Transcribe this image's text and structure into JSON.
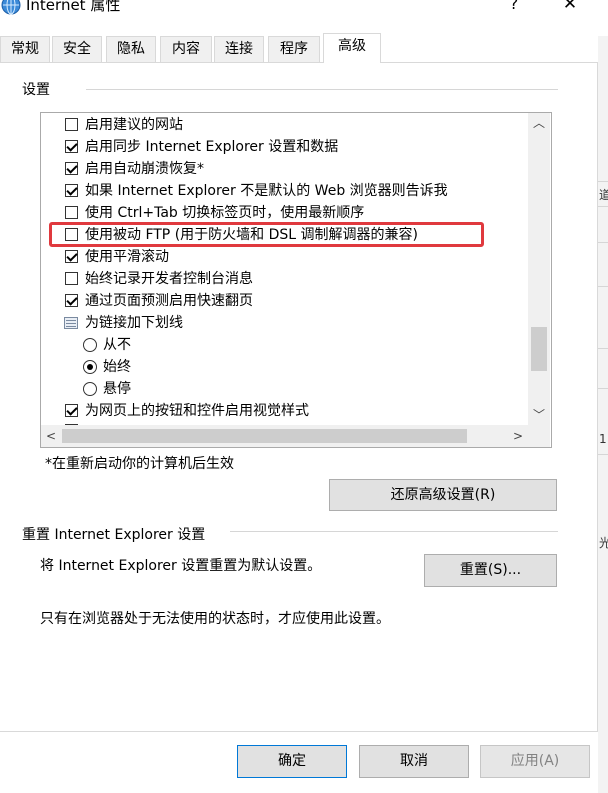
{
  "window": {
    "title": "Internet 属性",
    "help_label": "?",
    "close_label": "✕"
  },
  "tabs": [
    {
      "label": "常规",
      "active": false
    },
    {
      "label": "安全",
      "active": false
    },
    {
      "label": "隐私",
      "active": false
    },
    {
      "label": "内容",
      "active": false
    },
    {
      "label": "连接",
      "active": false
    },
    {
      "label": "程序",
      "active": false
    },
    {
      "label": "高级",
      "active": true
    }
  ],
  "settings": {
    "group_label": "设置",
    "items": [
      {
        "type": "checkbox",
        "label": "启用建议的网站",
        "checked": false
      },
      {
        "type": "checkbox",
        "label": "启用同步 Internet Explorer 设置和数据",
        "checked": true
      },
      {
        "type": "checkbox",
        "label": "启用自动崩溃恢复*",
        "checked": true
      },
      {
        "type": "checkbox",
        "label": "如果 Internet Explorer 不是默认的 Web 浏览器则告诉我",
        "checked": true
      },
      {
        "type": "checkbox",
        "label": "使用 Ctrl+Tab 切换标签页时，使用最新顺序",
        "checked": false
      },
      {
        "type": "checkbox",
        "label": "使用被动 FTP (用于防火墙和 DSL 调制解调器的兼容)",
        "checked": false
      },
      {
        "type": "checkbox",
        "label": "使用平滑滚动",
        "checked": true
      },
      {
        "type": "checkbox",
        "label": "始终记录开发者控制台消息",
        "checked": false
      },
      {
        "type": "checkbox",
        "label": "通过页面预测启用快速翻页",
        "checked": true
      },
      {
        "type": "group",
        "label": "为链接加下划线"
      },
      {
        "type": "radio",
        "label": "从不",
        "selected": false
      },
      {
        "type": "radio",
        "label": "始终",
        "selected": true
      },
      {
        "type": "radio",
        "label": "悬停",
        "selected": false
      },
      {
        "type": "checkbox",
        "label": "为网页上的按钮和控件启用视觉样式",
        "checked": true
      }
    ],
    "restart_note": "*在重新启动你的计算机后生效",
    "restore_button": "还原高级设置(R)"
  },
  "reset": {
    "group_label": "重置 Internet Explorer 设置",
    "description": "将 Internet Explorer 设置重置为默认设置。",
    "reset_button": "重置(S)...",
    "note": "只有在浏览器处于无法使用的状态时，才应使用此设置。"
  },
  "footer": {
    "ok_button": "确定",
    "cancel_button": "取消",
    "apply_button": "应用(A)"
  },
  "scrollbar": {
    "up_arrow": "︿",
    "down_arrow": "﹀",
    "left_arrow": "<",
    "right_arrow": ">"
  },
  "background_window": {
    "glyphs": [
      "道",
      "1",
      "光"
    ]
  },
  "colors": {
    "highlight": "#e0393e",
    "default_button_border": "#0078d7"
  }
}
